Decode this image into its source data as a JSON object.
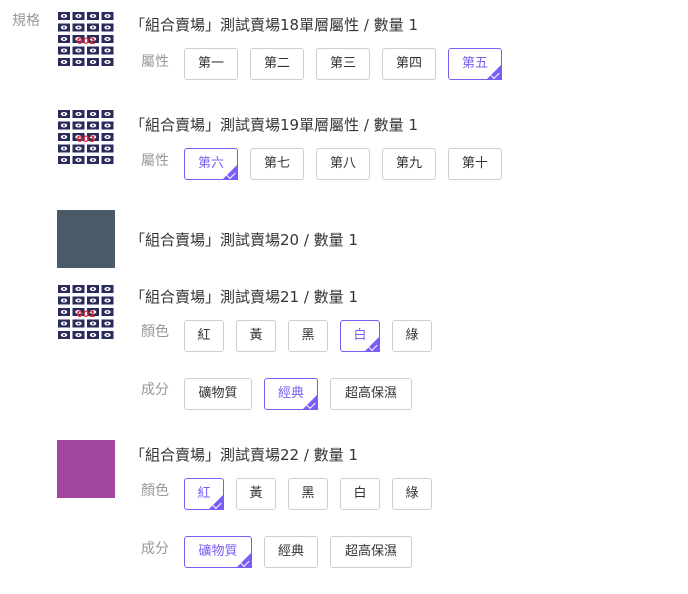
{
  "spec_label": "規格",
  "items": [
    {
      "title": "「組合賣場」測試賣場18單層屬性 / 數量 1",
      "thumb": {
        "kind": "pattern",
        "code": "002",
        "bg": "#ffffff"
      },
      "attrs": [
        {
          "label": "屬性",
          "options": [
            "第一",
            "第二",
            "第三",
            "第四",
            "第五"
          ],
          "selected": 4
        }
      ]
    },
    {
      "title": "「組合賣場」測試賣場19單層屬性 / 數量 1",
      "thumb": {
        "kind": "pattern",
        "code": "003",
        "bg": "#ffffff"
      },
      "attrs": [
        {
          "label": "屬性",
          "options": [
            "第六",
            "第七",
            "第八",
            "第九",
            "第十"
          ],
          "selected": 0
        }
      ]
    },
    {
      "title": "「組合賣場」測試賣場20 / 數量 1",
      "thumb": {
        "kind": "solid",
        "bg": "#4a5a68"
      },
      "attrs": []
    },
    {
      "title": "「組合賣場」測試賣場21 / 數量 1",
      "thumb": {
        "kind": "pattern",
        "code": "001",
        "bg": "#ffffff"
      },
      "attrs": [
        {
          "label": "顏色",
          "options": [
            "紅",
            "黃",
            "黑",
            "白",
            "綠"
          ],
          "selected": 3
        },
        {
          "label": "成分",
          "options": [
            "礦物質",
            "經典",
            "超高保濕"
          ],
          "selected": 1
        }
      ]
    },
    {
      "title": "「組合賣場」測試賣場22 / 數量 1",
      "thumb": {
        "kind": "solid",
        "bg": "#a346a0"
      },
      "attrs": [
        {
          "label": "顏色",
          "options": [
            "紅",
            "黃",
            "黑",
            "白",
            "綠"
          ],
          "selected": 0
        },
        {
          "label": "成分",
          "options": [
            "礦物質",
            "經典",
            "超高保濕"
          ],
          "selected": 0
        }
      ]
    }
  ],
  "colors": {
    "accent": "#7b5cf5",
    "muted": "#999999",
    "border": "#cfcfcf"
  }
}
